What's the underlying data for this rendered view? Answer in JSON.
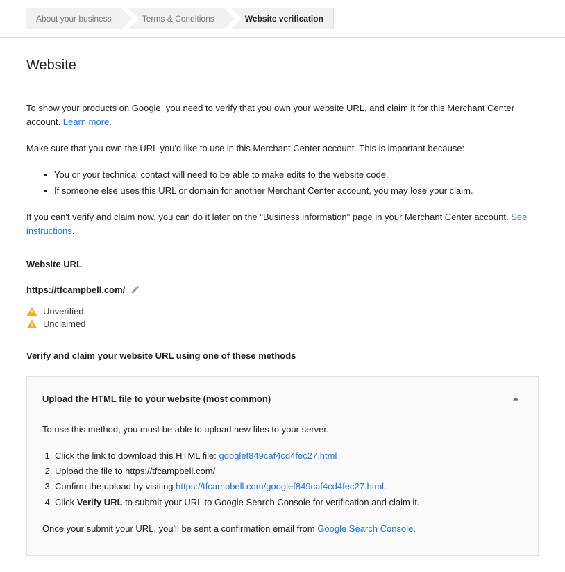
{
  "breadcrumb": {
    "items": [
      {
        "label": "About your business"
      },
      {
        "label": "Terms & Conditions"
      },
      {
        "label": "Website verification"
      }
    ]
  },
  "page": {
    "title": "Website",
    "intro_part1": "To show your products on Google, you need to verify that you own your website URL, and claim it for this Merchant Center account. ",
    "learn_more": "Learn more",
    "dot": ".",
    "ownership_note": "Make sure that you own the URL you'd like to use in this Merchant Center account. This is important because:",
    "bullets": [
      "You or your technical contact will need to be able to make edits to the website code.",
      "If someone else uses this URL or domain for another Merchant Center account, you may lose your claim."
    ],
    "later_note_part1": "If you can't verify and claim now, you can do it later on the \"Business information\" page in your Merchant Center account. ",
    "see_instructions": "See instructions"
  },
  "website_url_section": {
    "heading": "Website URL",
    "url": "https://tfcampbell.com/",
    "status": [
      {
        "label": "Unverified"
      },
      {
        "label": "Unclaimed"
      }
    ]
  },
  "methods": {
    "heading": "Verify and claim your website URL using one of these methods",
    "upload": {
      "title": "Upload the HTML file to your website (most common)",
      "intro": "To use this method, you must be able to upload new files to your server.",
      "step1_prefix": "Click the link to download this HTML file: ",
      "step1_link": "googlef849caf4cd4fec27.html",
      "step2": "Upload the file to https://tfcampbell.com/",
      "step3_prefix": "Confirm the upload by visiting ",
      "step3_link": "https://tfcampbell.com/googlef849caf4cd4fec27.html",
      "step4_prefix": "Click ",
      "step4_bold": "Verify URL",
      "step4_suffix": " to submit your URL to Google Search Console for verification and claim it.",
      "footer_prefix": "Once your submit your URL, you'll be sent a confirmation email from ",
      "footer_link": "Google Search Console",
      "footer_suffix": "."
    }
  }
}
